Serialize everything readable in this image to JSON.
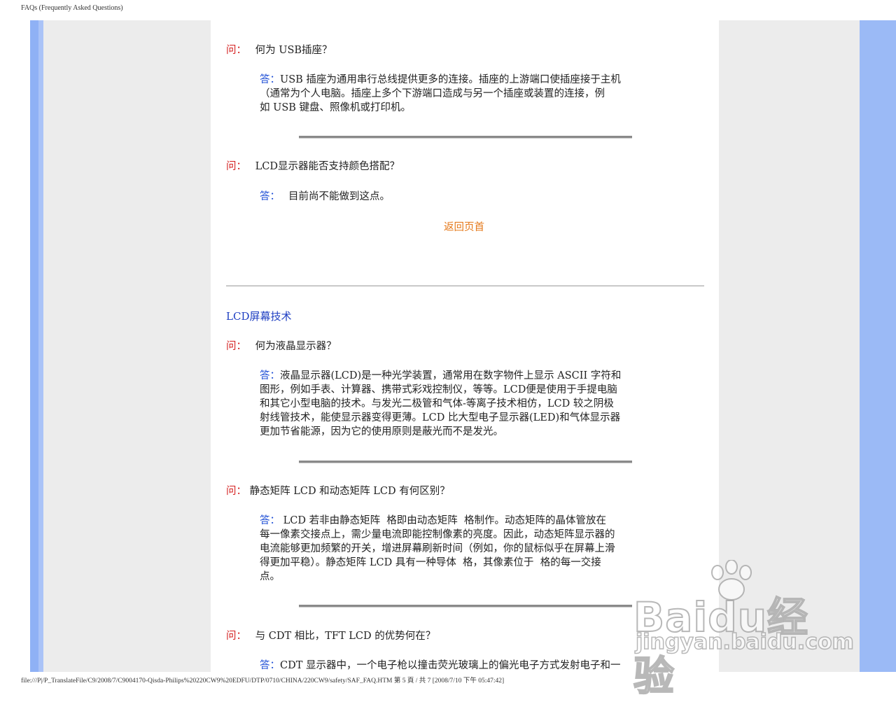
{
  "header": {
    "title": "FAQs (Frequently Asked Questions)"
  },
  "labels": {
    "question": "问：",
    "answer": "答："
  },
  "faq_top": [
    {
      "question": "何为 USB插座？",
      "answer_lines": [
        "USB 插座为通用串行总线提供更多的连接。插座的上游端口使插座接于主机",
        "（通常为个人电脑。插座上多个下游端口造成与另一个插座或装置的连接，例",
        "如 USB 键盘、照像机或打印机。"
      ]
    },
    {
      "question": "LCD显示器能否支持颜色搭配？",
      "answer_lines": [
        "目前尚不能做到这点。"
      ]
    }
  ],
  "back_to_top": "返回页首",
  "section": {
    "title": "LCD屏幕技术"
  },
  "faq_section": [
    {
      "question": "何为液晶显示器？",
      "answer_lines": [
        "液晶显示器(LCD)是一种光学装置，通常用在数字物件上显示 ASCII 字符和",
        "图形，例如手表、计算器、携带式彩戏控制仪，等等。LCD便是使用于手提电脑",
        "和其它小型电脑的技术。与发光二极管和气体-等离子技术相仿，LCD 较之阴极",
        "射线管技术，能使显示器变得更薄。LCD 比大型电子显示器(LED)和气体显示器",
        "更加节省能源，因为它的使用原则是蔽光而不是发光。"
      ]
    },
    {
      "question": "静态矩阵 LCD 和动态矩阵 LCD 有何区别？",
      "answer_lines": [
        " LCD 若非由静态矩阵  格即由动态矩阵  格制作。动态矩阵的晶体管放在",
        "每一像素交接点上，需少量电流即能控制像素的亮度。因此，动态矩阵显示器的",
        "电流能够更加频繁的开关，增进屏幕刷新时间（例如，你的鼠标似乎在屏幕上滑",
        "得更加平稳）。静态矩阵 LCD 具有一种导体  格，其像素位于  格的每一交接",
        "点。"
      ]
    },
    {
      "question": "与 CDT 相比，TFT LCD 的优势何在？",
      "answer_lines": [
        "CDT 显示器中，一个电子枪以撞击荧光玻璃上的偏光电子方式发射电子和一"
      ]
    }
  ],
  "footer": {
    "path": "file:///P|/P_TranslateFile/C9/2008/7/C9004170-Qisda-Philips%20220CW9%20EDFU/DTP/0710/CHINA/220CW9/safety/SAF_FAQ.HTM 第 5 頁 / 共 7  [2008/7/10 下午 05:47:42]"
  },
  "watermark": {
    "brand": "Baidu经验",
    "domain": "jingyan.baidu.com"
  }
}
